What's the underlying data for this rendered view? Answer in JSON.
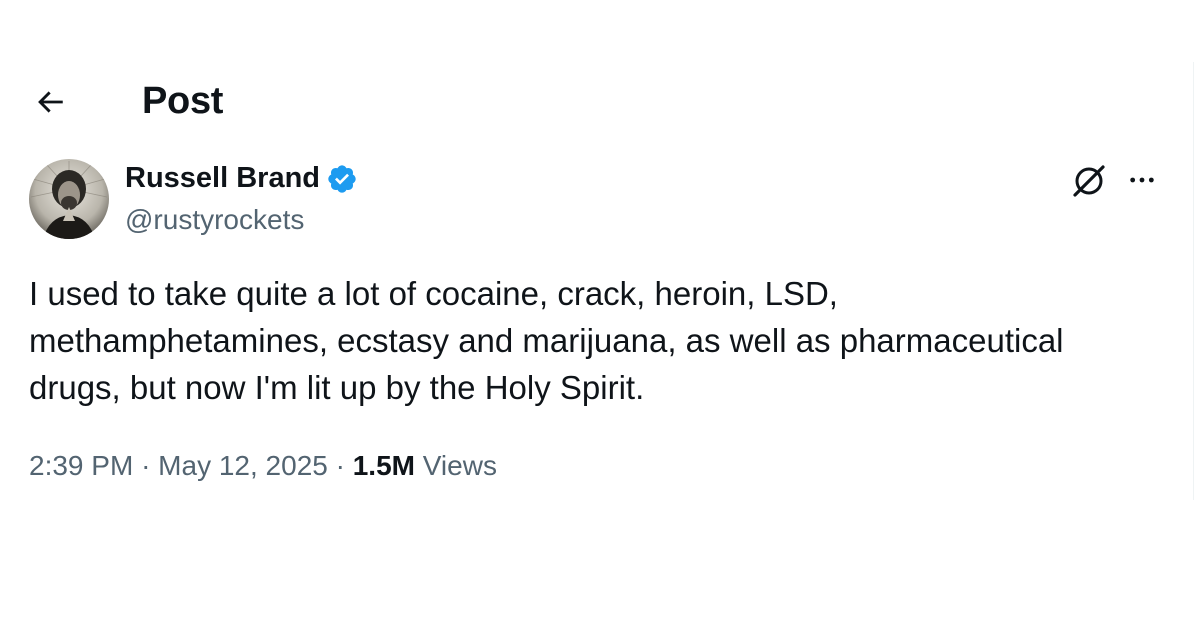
{
  "header": {
    "title": "Post"
  },
  "author": {
    "display_name": "Russell Brand",
    "handle": "@rustyrockets",
    "verified": true
  },
  "tweet": {
    "lines": [
      "I used to take quite a lot of cocaine, crack, heroin, LSD,",
      "methamphetamines, ecstasy and marijuana, as well as pharmaceutical",
      "drugs, but now I'm lit up by the Holy Spirit."
    ]
  },
  "meta": {
    "time": "2:39 PM",
    "separator": "·",
    "date": "May 12, 2025",
    "views_count": "1.5M",
    "views_label": "Views"
  },
  "icons": {
    "back": "arrow-left-icon",
    "verified": "verified-badge-icon",
    "grok": "grok-icon",
    "more": "more-horizontal-icon"
  },
  "colors": {
    "text": "#0f1419",
    "secondary": "#536471",
    "verified": "#1d9bf0",
    "border": "#eff3f4"
  }
}
